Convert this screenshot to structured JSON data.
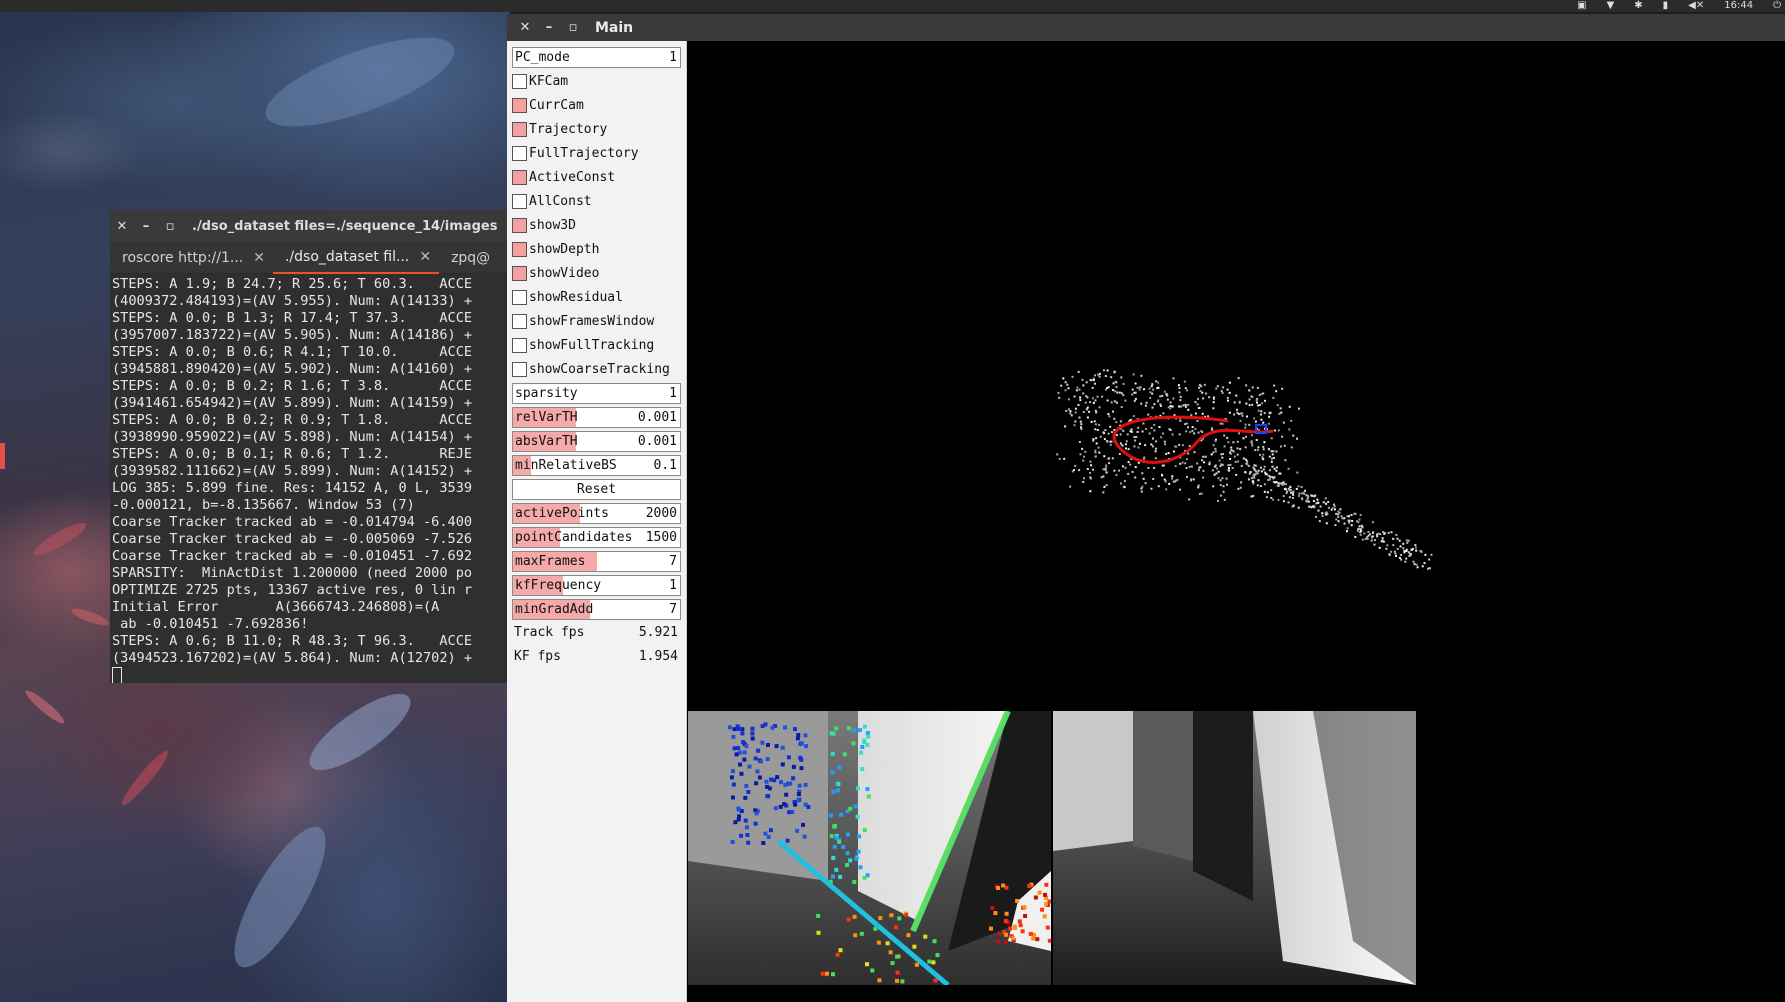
{
  "topbar": {
    "time": "16:44",
    "tray_icons": [
      "app-indicator-icon",
      "wifi-icon",
      "bluetooth-icon",
      "battery-icon",
      "volume-mute-icon",
      "power-icon"
    ]
  },
  "terminal": {
    "title": "./dso_dataset files=./sequence_14/images",
    "tabs": [
      {
        "label": "roscore http://1...",
        "active": false
      },
      {
        "label": "./dso_dataset fil...",
        "active": true
      },
      {
        "label": "zpq@",
        "active": false
      }
    ],
    "lines": [
      "STEPS: A 1.9; B 24.7; R 25.6; T 60.3.   ACCE",
      "(4009372.484193)=(AV 5.955). Num: A(14133) +",
      "STEPS: A 0.0; B 1.3; R 17.4; T 37.3.    ACCE",
      "(3957007.183722)=(AV 5.905). Num: A(14186) +",
      "STEPS: A 0.0; B 0.6; R 4.1; T 10.0.     ACCE",
      "(3945881.890420)=(AV 5.902). Num: A(14160) +",
      "STEPS: A 0.0; B 0.2; R 1.6; T 3.8.      ACCE",
      "(3941461.654942)=(AV 5.899). Num: A(14159) +",
      "STEPS: A 0.0; B 0.2; R 0.9; T 1.8.      ACCE",
      "(3938990.959022)=(AV 5.898). Num: A(14154) +",
      "STEPS: A 0.0; B 0.1; R 0.6; T 1.2.      REJE",
      "(3939582.111662)=(AV 5.899). Num: A(14152) +",
      "LOG 385: 5.899 fine. Res: 14152 A, 0 L, 3539",
      "-0.000121, b=-8.135667. Window 53 (7)",
      "Coarse Tracker tracked ab = -0.014794 -6.400",
      "Coarse Tracker tracked ab = -0.005069 -7.526",
      "Coarse Tracker tracked ab = -0.010451 -7.692",
      "SPARSITY:  MinActDist 1.200000 (need 2000 po",
      "OPTIMIZE 2725 pts, 13367 active res, 0 lin r",
      "Initial Error       A(3666743.246808)=(A",
      " ab -0.010451 -7.692836!",
      "STEPS: A 0.6; B 11.0; R 48.3; T 96.3.   ACCE",
      "(3494523.167202)=(AV 5.864). Num: A(12702) +"
    ]
  },
  "main": {
    "title": "Main",
    "panel": {
      "pc_mode": {
        "label": "PC_mode",
        "value": "1"
      },
      "checkboxes": [
        {
          "label": "KFCam",
          "checked": false
        },
        {
          "label": "CurrCam",
          "checked": true
        },
        {
          "label": "Trajectory",
          "checked": true
        },
        {
          "label": "FullTrajectory",
          "checked": false
        },
        {
          "label": "ActiveConst",
          "checked": true
        },
        {
          "label": "AllConst",
          "checked": false
        },
        {
          "label": "show3D",
          "checked": true
        },
        {
          "label": "showDepth",
          "checked": true
        },
        {
          "label": "showVideo",
          "checked": true
        },
        {
          "label": "showResidual",
          "checked": false
        },
        {
          "label": "showFramesWindow",
          "checked": false
        },
        {
          "label": "showFullTracking",
          "checked": false
        },
        {
          "label": "showCoarseTracking",
          "checked": false
        }
      ],
      "sliders_top": [
        {
          "label": "sparsity",
          "value": "1",
          "fill": 0.0
        },
        {
          "label": "relVarTH",
          "value": "0.001",
          "fill": 0.38
        },
        {
          "label": "absVarTH",
          "value": "0.001",
          "fill": 0.38
        },
        {
          "label": "minRelativeBS",
          "value": "0.1",
          "fill": 0.11
        }
      ],
      "reset_label": "Reset",
      "sliders_bottom": [
        {
          "label": "activePoints",
          "value": "2000",
          "fill": 0.4
        },
        {
          "label": "pointCandidates",
          "value": "1500",
          "fill": 0.28
        },
        {
          "label": "maxFrames",
          "value": "7",
          "fill": 0.5
        },
        {
          "label": "kfFrequency",
          "value": "1",
          "fill": 0.3
        },
        {
          "label": "minGradAdd",
          "value": "7",
          "fill": 0.46
        }
      ],
      "stats": [
        {
          "label": "Track fps",
          "value": "5.921"
        },
        {
          "label": "KF fps",
          "value": "1.954"
        }
      ]
    }
  },
  "colors": {
    "checkbox_on": "#f5a0a0",
    "slider_fill": "#f5a9a9",
    "trajectory": "#e01010",
    "terminal_tab_accent": "#e95420"
  }
}
